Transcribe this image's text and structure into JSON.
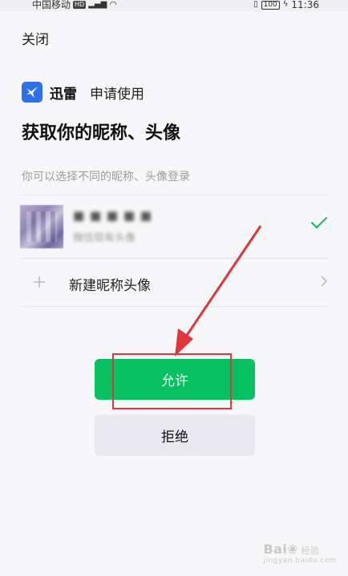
{
  "status_bar": {
    "carrier": "中国移动",
    "network_badge": "HD",
    "signal_text": "⁴ᴳ.ıl",
    "wifi_icon": "wifi-icon",
    "battery": "100",
    "time": "11:36"
  },
  "header": {
    "close_label": "关闭"
  },
  "app": {
    "name": "迅雷",
    "request_text": "申请使用",
    "logo_color": "#2f6fe8"
  },
  "page": {
    "title": "获取你的昵称、头像",
    "hint": "你可以选择不同的昵称、头像登录"
  },
  "profile": {
    "nickname": "■ ■ ■ ■ ■",
    "subtitle": "微信现有头像",
    "selected": true
  },
  "new_profile": {
    "label": "新建昵称头像"
  },
  "buttons": {
    "allow": "允许",
    "deny": "拒绝"
  },
  "colors": {
    "accent_green": "#07c160",
    "annotation_red": "#e0353b",
    "deny_bg": "#e9e8ee"
  },
  "watermark": {
    "brand": "Bai",
    "brand_tail": "经验",
    "url": "jingyan.baidu.com"
  }
}
